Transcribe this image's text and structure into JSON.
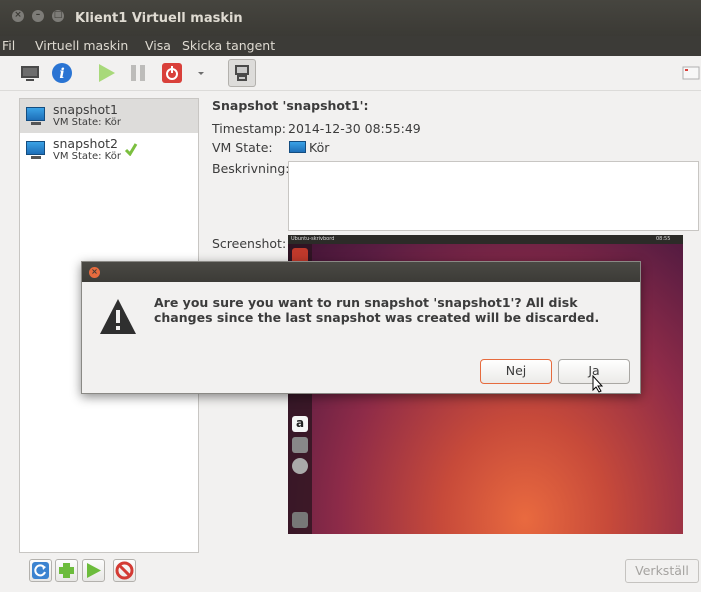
{
  "window": {
    "title": "Klient1 Virtuell maskin"
  },
  "menu": [
    "Fil",
    "Virtuell maskin",
    "Visa",
    "Skicka tangent"
  ],
  "snapshots": [
    {
      "name": "snapshot1",
      "state": "VM State: Kör"
    },
    {
      "name": "snapshot2",
      "state": "VM State: Kör"
    }
  ],
  "details": {
    "heading": "Snapshot 'snapshot1':",
    "timestamp_label": "Timestamp:",
    "timestamp": "2014-12-30 08:55:49",
    "state_label": "VM State:",
    "state": "Kör",
    "description_label": "Beskrivning:",
    "description": "",
    "screenshot_label": "Screenshot:",
    "screenshot_topbar_title": "Ubuntu-skrivbord",
    "screenshot_topbar_clock": "08:55"
  },
  "bottom": {
    "apply": "Verkställ"
  },
  "dialog": {
    "message": "Are you sure you want to run snapshot 'snapshot1'? All disk changes since the last snapshot was created will be discarded.",
    "no": "Nej",
    "yes": "Ja"
  },
  "colors": {
    "accent": "#e66b3e",
    "titlebar": "#3c3b37",
    "selected_row": "#dddcda"
  }
}
